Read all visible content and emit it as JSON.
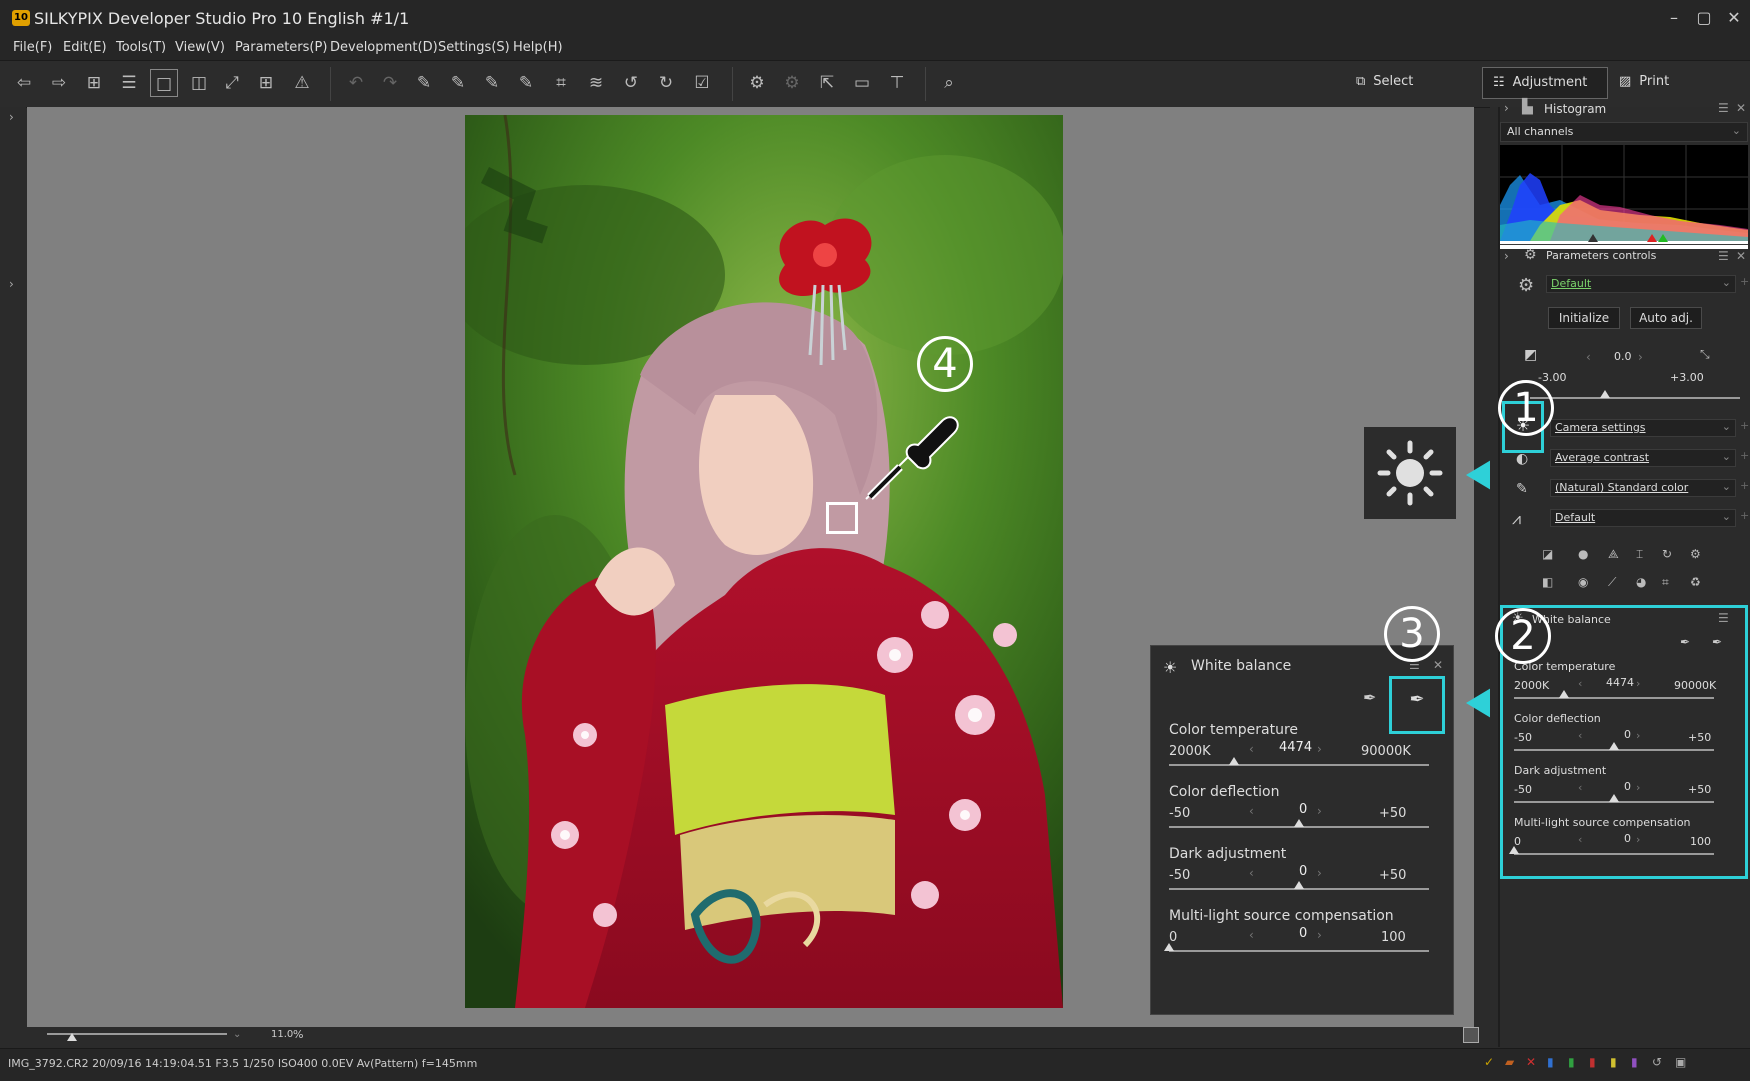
{
  "window": {
    "app_icon_label": "10",
    "title": "SILKYPIX Developer Studio Pro 10 English   #1/1",
    "minimize": "–",
    "maximize": "▢",
    "close": "✕"
  },
  "menu": [
    "File(F)",
    "Edit(E)",
    "Tools(T)",
    "View(V)",
    "Parameters(P)",
    "Development(D)",
    "Settings(S)",
    "Help(H)"
  ],
  "toolbar": {
    "select_label": "Select",
    "adjustment_label": "Adjustment",
    "print_label": "Print"
  },
  "viewer": {
    "zoom_value": "11.0",
    "zoom_unit": "%"
  },
  "status": {
    "info": "IMG_3792.CR2 20/09/16 14:19:04.51 F3.5 1/250 ISO400  0.0EV Av(Pattern) f=145mm"
  },
  "histogram": {
    "title": "Histogram",
    "channel": "All channels"
  },
  "params": {
    "title": "Parameters controls",
    "taste": "Default",
    "initialize": "Initialize",
    "auto_adj": "Auto adj.",
    "exposure_value": "0.0",
    "exposure_min": "-3.00",
    "exposure_max": "+3.00",
    "wb_preset": "Camera settings",
    "tone_preset": "Average contrast",
    "color_preset": "(Natural) Standard color",
    "sharp_preset": "Default"
  },
  "white_balance": {
    "title": "White balance",
    "color_temperature": {
      "label": "Color temperature",
      "min": "2000K",
      "value": "4474",
      "max": "90000K",
      "level": 0.25
    },
    "color_deflection": {
      "label": "Color deflection",
      "min": "-50",
      "value": "0",
      "max": "+50",
      "level": 0.5
    },
    "dark_adjustment": {
      "label": "Dark adjustment",
      "min": "-50",
      "value": "0",
      "max": "+50",
      "level": 0.5
    },
    "multi_light": {
      "label": "Multi-light source compensation",
      "min": "0",
      "value": "0",
      "max": "100",
      "level": 0.0
    }
  },
  "callouts": {
    "one": "1",
    "two": "2",
    "three": "3",
    "four": "4"
  },
  "colors": {
    "highlight": "#2ed0d8",
    "link_green": "#7bd36b"
  }
}
